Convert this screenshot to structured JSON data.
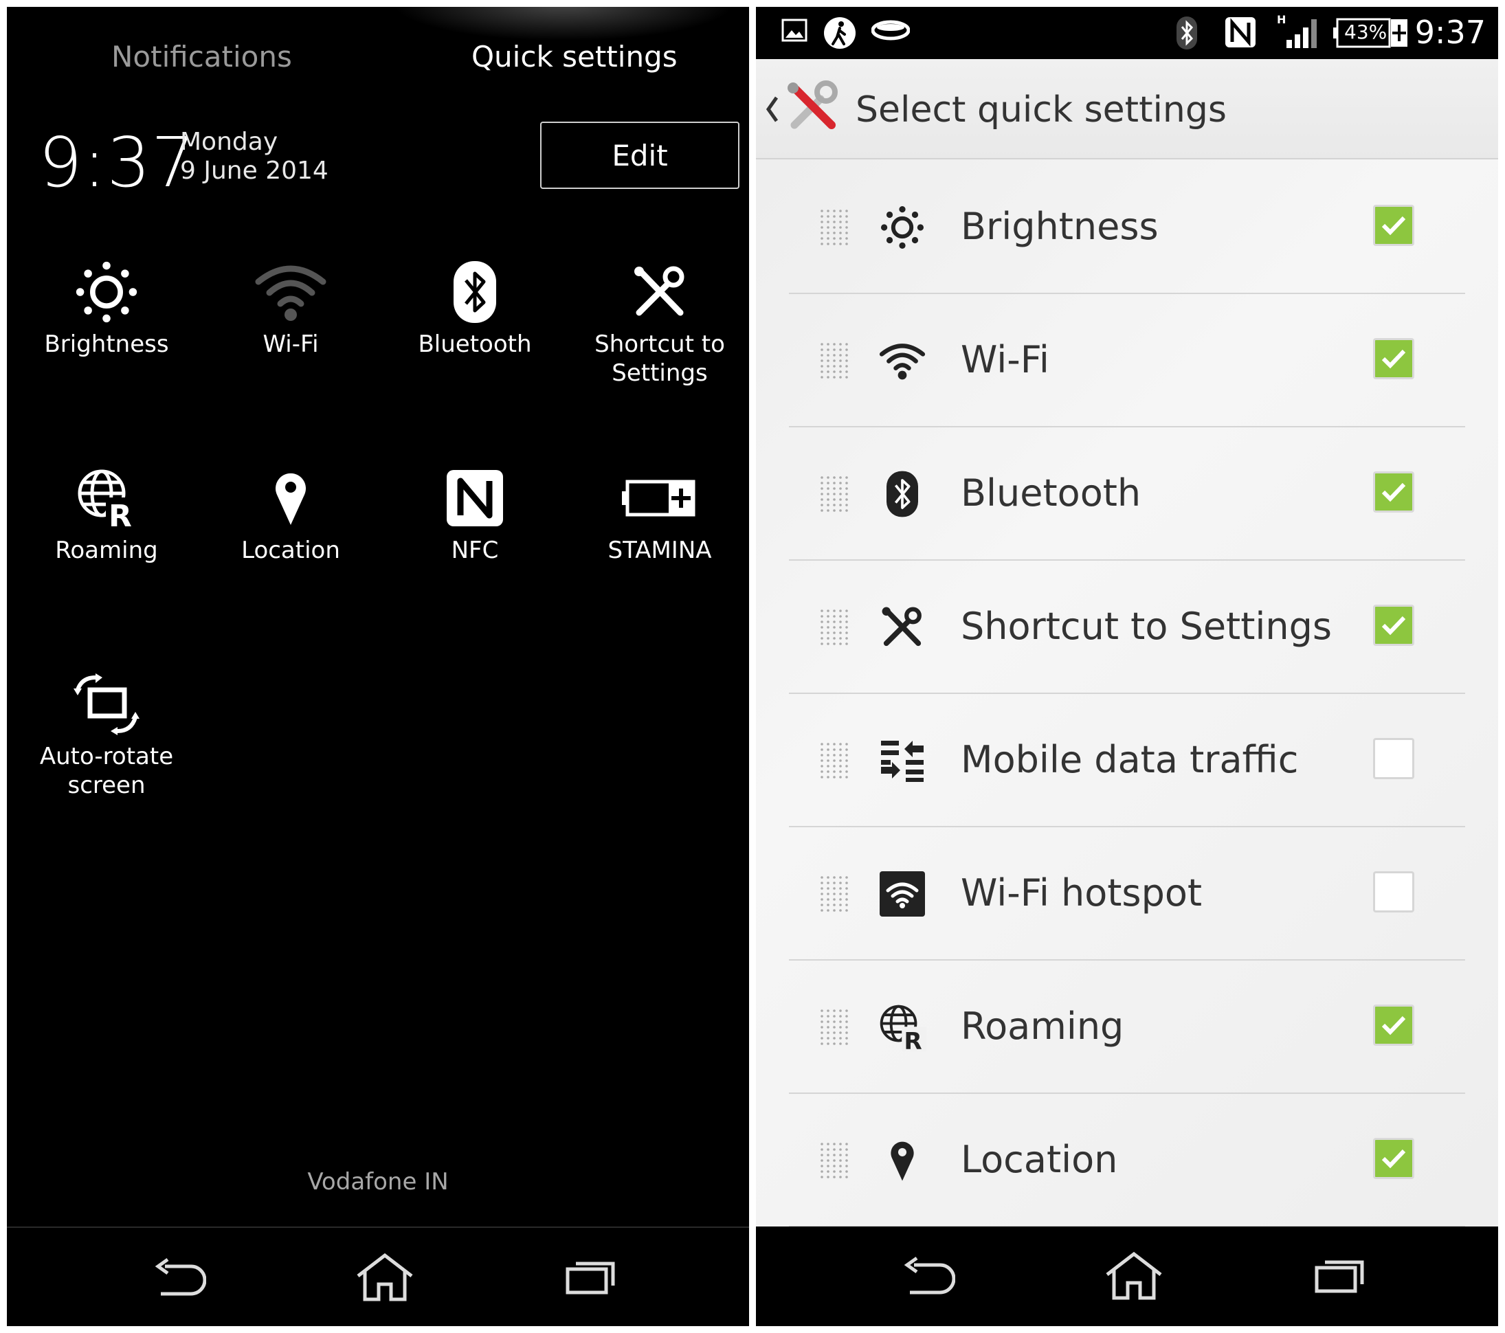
{
  "left": {
    "tabs": {
      "notifications": "Notifications",
      "quick_settings": "Quick settings"
    },
    "clock": {
      "time": "9:37",
      "day": "Monday",
      "date": "9 June 2014"
    },
    "edit_label": "Edit",
    "tiles": [
      {
        "label": "Brightness",
        "icon": "brightness-icon"
      },
      {
        "label": "Wi-Fi",
        "icon": "wifi-icon"
      },
      {
        "label": "Bluetooth",
        "icon": "bluetooth-icon"
      },
      {
        "label": "Shortcut to Settings",
        "icon": "settings-tools-icon"
      },
      {
        "label": "Roaming",
        "icon": "roaming-icon"
      },
      {
        "label": "Location",
        "icon": "location-pin-icon"
      },
      {
        "label": "NFC",
        "icon": "nfc-icon"
      },
      {
        "label": "STAMINA",
        "icon": "battery-stamina-icon"
      },
      {
        "label": "Auto-rotate screen",
        "icon": "rotate-icon"
      }
    ],
    "carrier": "Vodafone IN"
  },
  "right": {
    "status": {
      "time": "9:37",
      "battery": "43%",
      "network": "H"
    },
    "title": "Select quick settings",
    "items": [
      {
        "label": "Brightness",
        "checked": true,
        "icon": "brightness-icon"
      },
      {
        "label": "Wi-Fi",
        "checked": true,
        "icon": "wifi-icon"
      },
      {
        "label": "Bluetooth",
        "checked": true,
        "icon": "bluetooth-icon"
      },
      {
        "label": "Shortcut to Settings",
        "checked": true,
        "icon": "settings-tools-icon"
      },
      {
        "label": "Mobile data traffic",
        "checked": false,
        "icon": "data-traffic-icon"
      },
      {
        "label": "Wi-Fi hotspot",
        "checked": false,
        "icon": "hotspot-icon"
      },
      {
        "label": "Roaming",
        "checked": true,
        "icon": "roaming-icon"
      },
      {
        "label": "Location",
        "checked": true,
        "icon": "location-pin-icon"
      }
    ]
  },
  "colors": {
    "check_green": "#8dc63f",
    "background_dark": "#000000",
    "list_bg": "#efefef"
  }
}
